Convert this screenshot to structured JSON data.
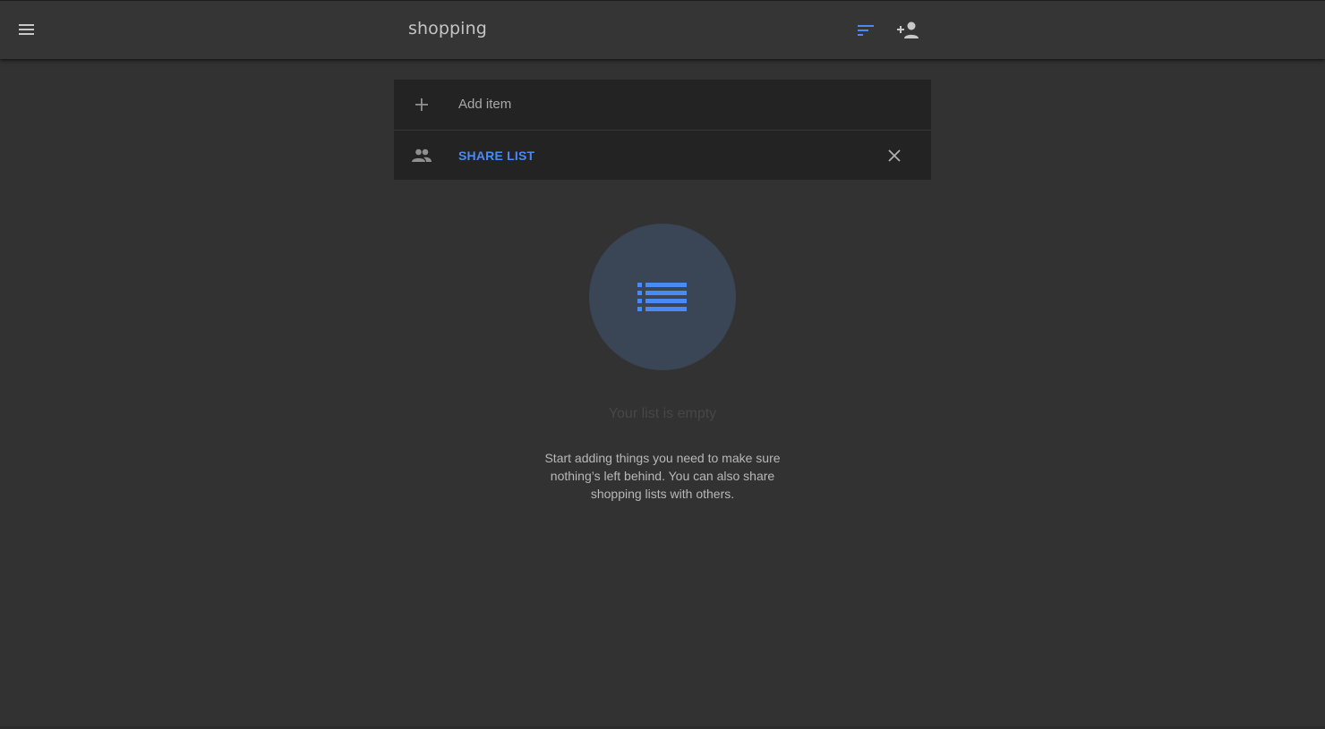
{
  "header": {
    "title": "shopping",
    "icons": {
      "menu": "menu-icon",
      "sort": "sort-icon",
      "add_person": "person-add-icon"
    }
  },
  "list_card": {
    "add_item_placeholder": "Add item",
    "share_label": "SHARE LIST",
    "icons": {
      "add": "plus-icon",
      "share": "people-icon",
      "dismiss": "close-icon"
    }
  },
  "empty_state": {
    "icon": "list-icon",
    "title": "Your list is empty",
    "description": "Start adding things you need to make sure nothing’s left behind. You can also share shopping lists with others."
  },
  "colors": {
    "accent": "#4a8af4",
    "background": "#323232",
    "card": "#232323",
    "appbar": "#353535",
    "empty_circle": "#3a4556"
  }
}
